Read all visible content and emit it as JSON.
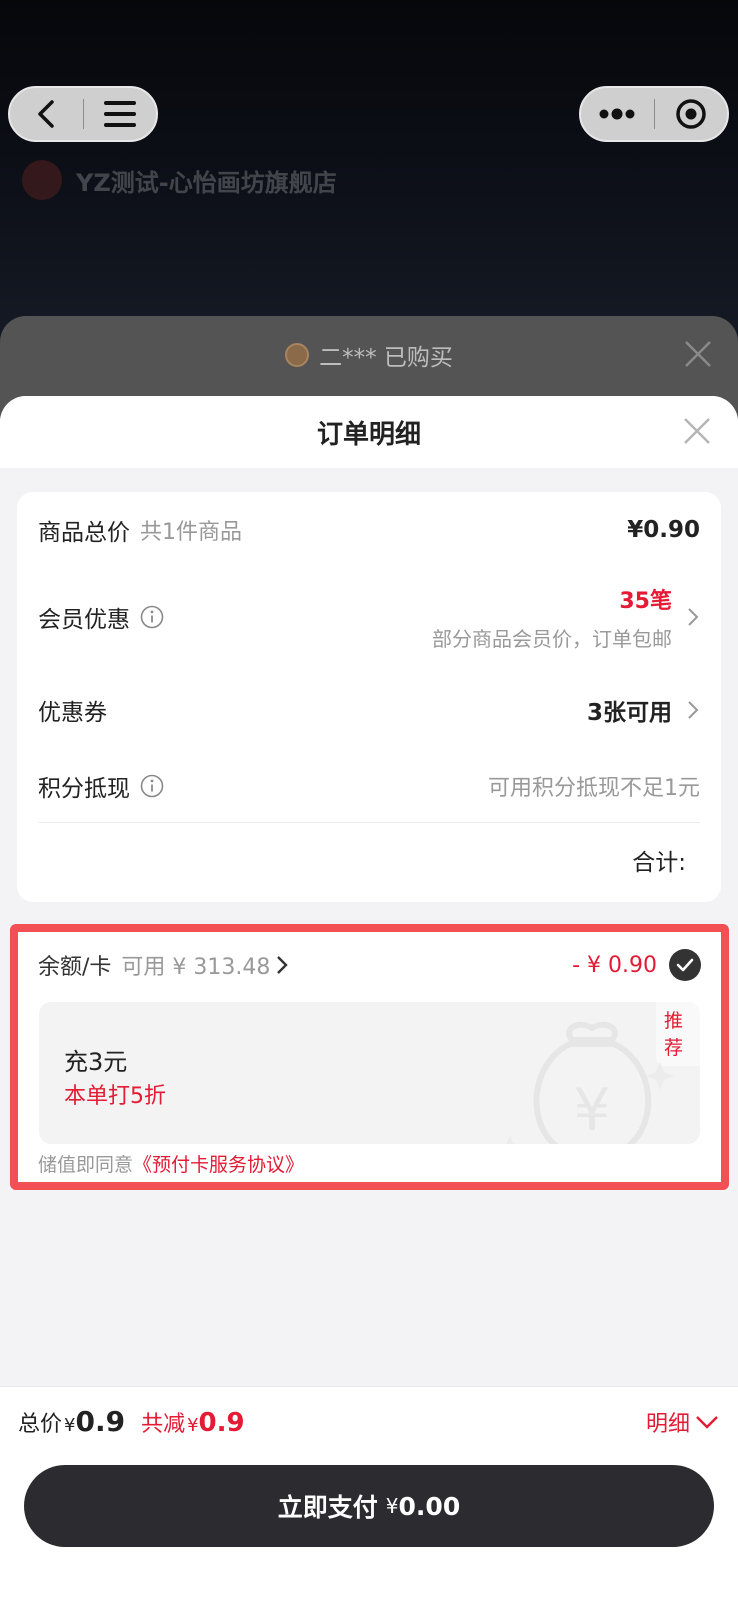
{
  "store": {
    "name": "YZ测试-心怡画坊旗舰店"
  },
  "toast": {
    "text": "二*** 已购买"
  },
  "sheet": {
    "title": "订单明细"
  },
  "detail": {
    "goods_total_label": "商品总价",
    "goods_count": "共1件商品",
    "goods_total_value": "¥0.90",
    "member_label": "会员优惠",
    "member_count": "35笔",
    "member_desc": "部分商品会员价，订单包邮",
    "coupon_label": "优惠券",
    "coupon_value": "3张可用",
    "points_label": "积分抵现",
    "points_value": "可用积分抵现不足1元",
    "total_label": "合计:"
  },
  "balance": {
    "label": "余额/卡",
    "available": "可用 ¥ 313.48",
    "deduction": "- ¥ 0.90",
    "recharge_title": "充3元",
    "recharge_sub": "本单打5折",
    "recharge_tag": "推荐",
    "agree_prefix": "储值即同意",
    "agree_link": "《预付卡服务协议》"
  },
  "bottom": {
    "total_label": "总价",
    "currency": "¥",
    "total_value": "0.9",
    "discount_label": "共减",
    "discount_value": "0.9",
    "detail_toggle": "明细",
    "pay_label": "立即支付",
    "pay_amount": "0.00"
  }
}
